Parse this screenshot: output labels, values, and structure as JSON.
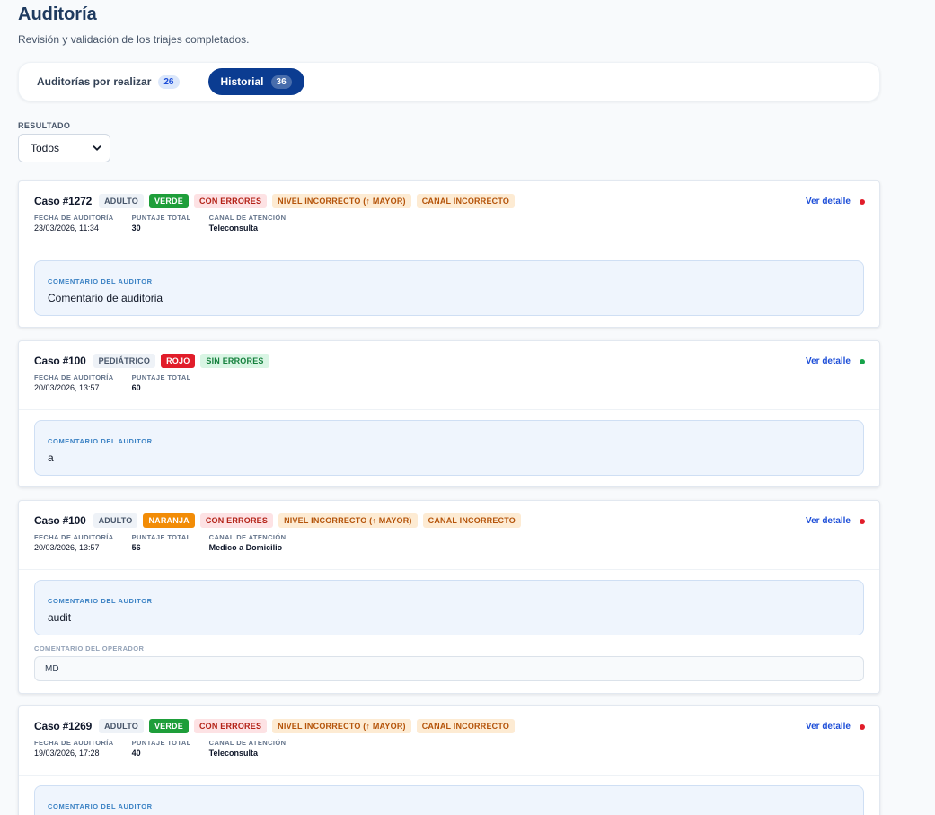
{
  "page": {
    "title": "Auditoría",
    "subtitle": "Revisión y validación de los triajes completados."
  },
  "tabs": [
    {
      "label": "Auditorías por realizar",
      "count": "26",
      "active": false
    },
    {
      "label": "Historial",
      "count": "36",
      "active": true
    }
  ],
  "filter": {
    "label": "RESULTADO",
    "value": "Todos"
  },
  "labels": {
    "fecha": "FECHA DE AUDITORÍA",
    "puntaje": "PUNTAJE TOTAL",
    "canal": "CANAL DE ATENCIÓN",
    "auditor": "COMENTARIO DEL AUDITOR",
    "operador": "COMENTARIO DEL OPERADOR",
    "ver_detalle": "Ver detalle"
  },
  "colors": {
    "accent": "#0b3c91",
    "verde": "#1e9e3a",
    "rojo": "#e11d2a",
    "naranja": "#f28c06",
    "status_error": "#e11d2a",
    "status_ok": "#16a34a"
  },
  "cases": [
    {
      "title": "Caso #1272",
      "age": "ADULTO",
      "level": "VERDE",
      "result": "CON ERRORES",
      "tags": [
        "NIVEL INCORRECTO (↑ MAYOR)",
        "CANAL INCORRECTO"
      ],
      "fecha": "23/03/2026, 11:34",
      "puntaje": "30",
      "canal": "Teleconsulta",
      "status": "error",
      "auditor_comment": "Comentario de auditoria",
      "operator_comment": ""
    },
    {
      "title": "Caso #100",
      "age": "PEDIÁTRICO",
      "level": "ROJO",
      "result": "SIN ERRORES",
      "tags": [],
      "fecha": "20/03/2026, 13:57",
      "puntaje": "60",
      "canal": "",
      "status": "ok",
      "auditor_comment": "a",
      "operator_comment": ""
    },
    {
      "title": "Caso #100",
      "age": "ADULTO",
      "level": "NARANJA",
      "result": "CON ERRORES",
      "tags": [
        "NIVEL INCORRECTO (↑ MAYOR)",
        "CANAL INCORRECTO"
      ],
      "fecha": "20/03/2026, 13:57",
      "puntaje": "56",
      "canal": "Medico a Domicilio",
      "status": "error",
      "auditor_comment": "audit",
      "operator_comment": "MD"
    },
    {
      "title": "Caso #1269",
      "age": "ADULTO",
      "level": "VERDE",
      "result": "CON ERRORES",
      "tags": [
        "NIVEL INCORRECTO (↑ MAYOR)",
        "CANAL INCORRECTO"
      ],
      "fecha": "19/03/2026, 17:28",
      "puntaje": "40",
      "canal": "Teleconsulta",
      "status": "error",
      "auditor_comment": "",
      "operator_comment": ""
    }
  ]
}
